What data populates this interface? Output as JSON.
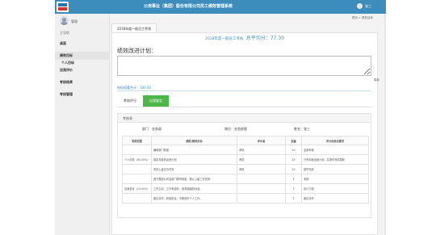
{
  "header": {
    "title": "公用事业（集团）股份有限公司员工绩效管理系统",
    "user_name": "张三"
  },
  "sidebar": {
    "user_name": "管理",
    "menu_label": "主导航",
    "items": [
      {
        "label": "桌面"
      },
      {
        "label": "绩效目标"
      },
      {
        "label": "个人目标"
      },
      {
        "label": "自我评价"
      },
      {
        "label": "考核结果"
      },
      {
        "label": "考核管理"
      }
    ]
  },
  "breadcrumb": "首页 > 绩效目标",
  "page_tab": "2018年度一般员工考核",
  "form": {
    "title": "2018年度一般员工考核",
    "score_label": "总平均分：77.30",
    "plan_label": "绩效改进计划：",
    "save_label": "保存",
    "weight_total": "指标权重合计：100.00"
  },
  "sub_tabs": [
    "考核评分",
    "自我鉴定"
  ],
  "sheet": {
    "title": "考核表",
    "dept": "部门：业务部",
    "post": "岗位：业务经理",
    "name": "姓名：张三"
  },
  "table": {
    "headers": [
      "考核范围",
      "绩效/绩效目标",
      "评价者",
      "权重",
      "评分标准及要求"
    ],
    "rows": [
      [
        "",
        "编制部门制度",
        "考核",
        "10",
        "全部考核"
      ],
      [
        "个人绩效（85.00%）",
        "制定年度的运营计划",
        "考核",
        "25",
        "已有年度运营计划，并按时完成更新"
      ],
      [
        "",
        "完成上级交办任务",
        "考核",
        "10",
        "按时完成"
      ],
      [
        "",
        "遵守集团公司及部门规章制度，服从上级工作安排。",
        "",
        "5",
        "考核"
      ],
      [
        "自我鉴定（15.00%）",
        "工作主动，工作有激情，追求超越的标准。",
        "",
        "5",
        "执行力强"
      ],
      [
        "",
        "团队协作，积极配合，不断提升个人工作。",
        "",
        "5",
        "团队协作"
      ]
    ]
  },
  "colors": {
    "header": "#3c8dbc",
    "accent": "#3c8dbc",
    "tab_green": "#4cb849"
  }
}
